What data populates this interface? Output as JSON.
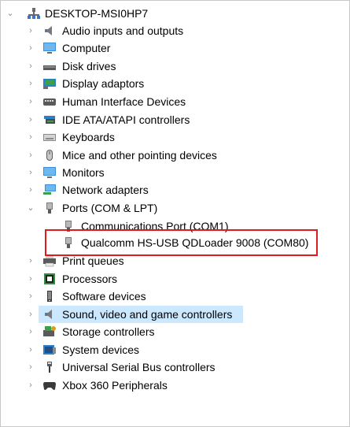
{
  "tree": {
    "root": {
      "label": "DESKTOP-MSI0HP7",
      "icon": "computer-tree-icon",
      "state": "expanded"
    },
    "categories": [
      {
        "label": "Audio inputs and outputs",
        "icon": "speaker-icon",
        "state": "collapsed"
      },
      {
        "label": "Computer",
        "icon": "monitor-icon",
        "state": "collapsed"
      },
      {
        "label": "Disk drives",
        "icon": "disk-drive-icon",
        "state": "collapsed"
      },
      {
        "label": "Display adaptors",
        "icon": "display-adapter-icon",
        "state": "collapsed"
      },
      {
        "label": "Human Interface Devices",
        "icon": "hid-icon",
        "state": "collapsed"
      },
      {
        "label": "IDE ATA/ATAPI controllers",
        "icon": "ide-controller-icon",
        "state": "collapsed"
      },
      {
        "label": "Keyboards",
        "icon": "keyboard-icon",
        "state": "collapsed"
      },
      {
        "label": "Mice and other pointing devices",
        "icon": "mouse-icon",
        "state": "collapsed"
      },
      {
        "label": "Monitors",
        "icon": "monitor-icon",
        "state": "collapsed"
      },
      {
        "label": "Network adapters",
        "icon": "network-adapter-icon",
        "state": "collapsed"
      },
      {
        "label": "Ports (COM & LPT)",
        "icon": "port-icon",
        "state": "expanded"
      },
      {
        "label": "Print queues",
        "icon": "printer-icon",
        "state": "collapsed"
      },
      {
        "label": "Processors",
        "icon": "processor-icon",
        "state": "collapsed"
      },
      {
        "label": "Software devices",
        "icon": "software-device-icon",
        "state": "collapsed"
      },
      {
        "label": "Sound, video and game controllers",
        "icon": "speaker-icon",
        "state": "collapsed",
        "selected": true
      },
      {
        "label": "Storage controllers",
        "icon": "storage-controller-icon",
        "state": "collapsed"
      },
      {
        "label": "System devices",
        "icon": "system-devices-icon",
        "state": "collapsed"
      },
      {
        "label": "Universal Serial Bus controllers",
        "icon": "usb-icon",
        "state": "collapsed"
      },
      {
        "label": "Xbox 360 Peripherals",
        "icon": "gamepad-icon",
        "state": "collapsed"
      }
    ],
    "ports_children": [
      {
        "label": "Communications Port (COM1)",
        "icon": "port-icon"
      },
      {
        "label": "Qualcomm HS-USB QDLoader 9008 (COM80)",
        "icon": "port-icon",
        "highlighted": true
      }
    ]
  },
  "colors": {
    "selection": "#cce8ff",
    "highlight_border": "#e01b1b",
    "chevron": "#8a8a8a"
  }
}
